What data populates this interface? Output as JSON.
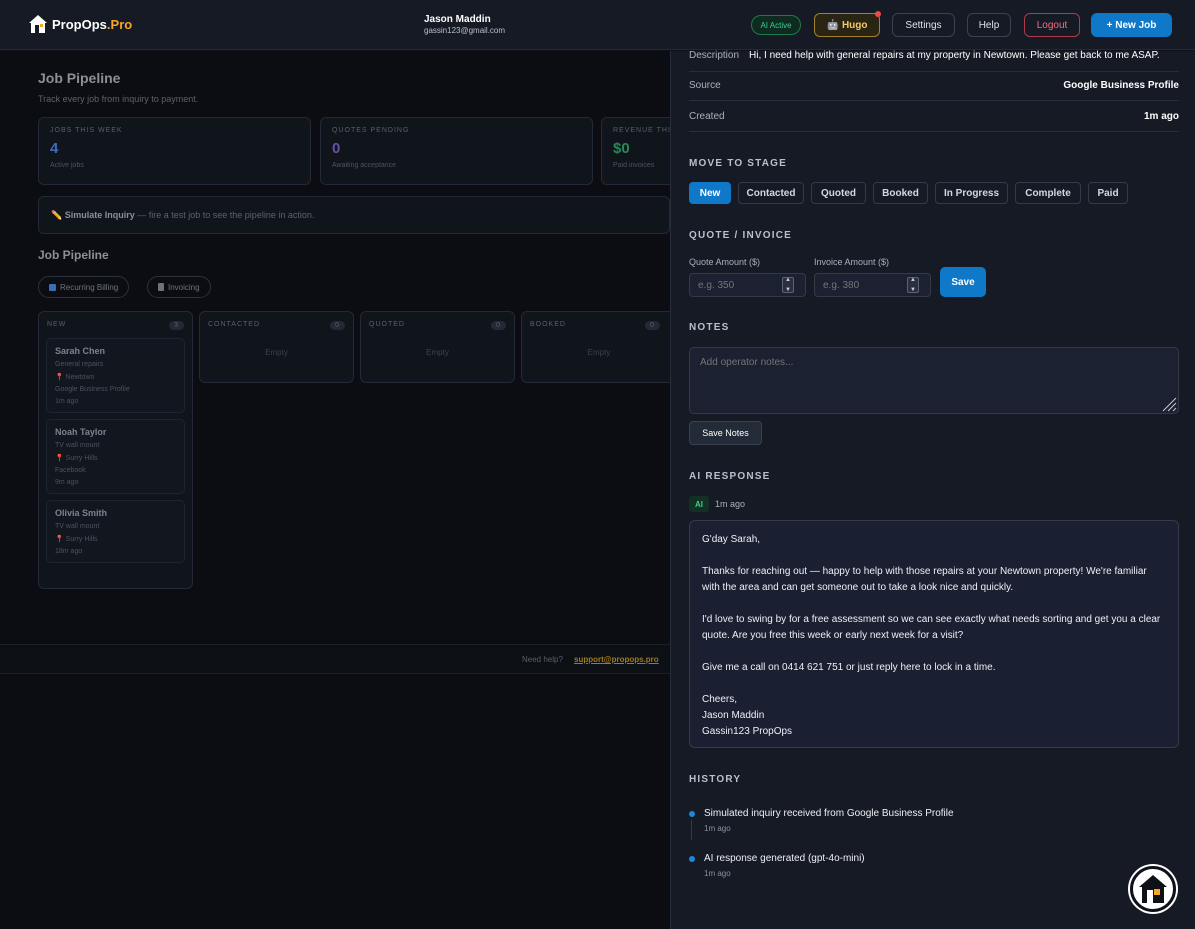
{
  "app": {
    "logo_main": "PropOps",
    "logo_accent": ".Pro"
  },
  "user": {
    "name": "Jason Maddin",
    "email": "gassin123@gmail.com"
  },
  "topbar": {
    "ai_status": "AI Active",
    "hugo_label": "Hugo",
    "settings": "Settings",
    "help": "Help",
    "logout": "Logout",
    "new_job": "+ New Job"
  },
  "dashboard": {
    "title": "Job Pipeline",
    "subtitle": "Track every job from inquiry to payment.",
    "stats": [
      {
        "label": "JOBS THIS WEEK",
        "value": "4",
        "foot": "Active jobs",
        "color": "#4a7fd8"
      },
      {
        "label": "QUOTES PENDING",
        "value": "0",
        "foot": "Awaiting acceptance",
        "color": "#7a5cc8"
      },
      {
        "label": "REVENUE THI",
        "value": "$0",
        "foot": "Paid invoices",
        "color": "#2aa86a"
      }
    ],
    "simulate_bold": "Simulate Inquiry",
    "simulate_rest": " — fire a test job to see the pipeline in action.",
    "pipeline_title": "Job Pipeline",
    "chips": [
      "Recurring Billing",
      "Invoicing"
    ],
    "columns": [
      {
        "name": "NEW",
        "count": "3"
      },
      {
        "name": "CONTACTED",
        "count": "0",
        "empty": "Empty"
      },
      {
        "name": "QUOTED",
        "count": "0",
        "empty": "Empty"
      },
      {
        "name": "BOOKED",
        "count": "0",
        "empty": "Empty"
      }
    ],
    "jobs": [
      {
        "name": "Sarah Chen",
        "service": "General repairs",
        "location": "📍 Newtown",
        "source": "Google Business Profile",
        "time": "1m ago"
      },
      {
        "name": "Noah Taylor",
        "service": "TV wall mount",
        "location": "📍 Surry Hills",
        "source": "Facebook",
        "time": "9m ago"
      },
      {
        "name": "Olivia Smith",
        "service": "TV wall mount",
        "location": "📍 Surry Hills",
        "time": "18m ago"
      }
    ],
    "footer_help": "Need help?",
    "footer_link": "support@propops.pro"
  },
  "panel": {
    "description_key": "Description",
    "description_val": "Hi, I need help with general repairs at my property in Newtown. Please get back to me ASAP.",
    "source_key": "Source",
    "source_val": "Google Business Profile",
    "created_key": "Created",
    "created_val": "1m ago",
    "move_title": "MOVE TO STAGE",
    "stages": [
      "New",
      "Contacted",
      "Quoted",
      "Booked",
      "In Progress",
      "Complete",
      "Paid"
    ],
    "active_stage": "New",
    "quote_title": "QUOTE / INVOICE",
    "quote_label": "Quote Amount ($)",
    "quote_placeholder": "e.g. 350",
    "invoice_label": "Invoice Amount ($)",
    "invoice_placeholder": "e.g. 380",
    "save": "Save",
    "notes_title": "NOTES",
    "notes_placeholder": "Add operator notes...",
    "save_notes": "Save Notes",
    "ai_title": "AI RESPONSE",
    "ai_tag": "AI",
    "ai_time": "1m ago",
    "ai_paragraphs": [
      "G'day Sarah,",
      "Thanks for reaching out — happy to help with those repairs at your Newtown property! We're familiar with the area and can get someone out to take a look nice and quickly.",
      "I'd love to swing by for a free assessment so we can see exactly what needs sorting and get you a clear quote. Are you free this week or early next week for a visit?",
      "Give me a call on 0414 621 751 or just reply here to lock in a time."
    ],
    "ai_signoff": [
      "Cheers,",
      "Jason Maddin",
      "Gassin123 PropOps"
    ],
    "history_title": "HISTORY",
    "history": [
      {
        "text": "Simulated inquiry received from Google Business Profile",
        "time": "1m ago"
      },
      {
        "text": "AI response generated (gpt-4o-mini)",
        "time": "1m ago"
      }
    ]
  },
  "icons": {
    "logo": "house-logo-icon",
    "hugo": "robot-icon",
    "chat": "chat-launcher-icon"
  },
  "colors": {
    "accent": "#0f78c8",
    "brand_orange": "#f5a623",
    "success": "#3ad08a",
    "danger": "#f07080"
  }
}
